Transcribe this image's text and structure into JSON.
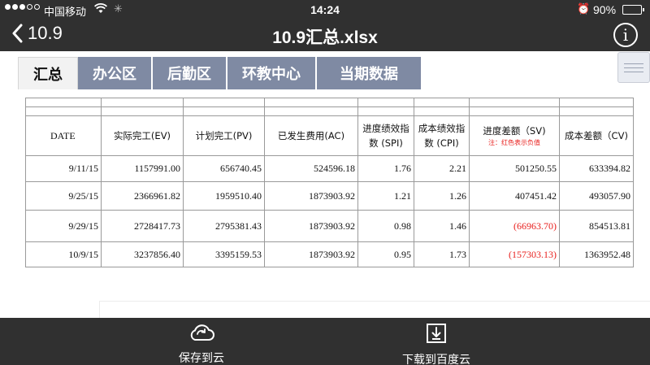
{
  "status_bar": {
    "carrier": "中国移动",
    "time": "14:24",
    "battery_percent": "90%",
    "battery_level": 0.9
  },
  "nav": {
    "back_label": "10.9",
    "title": "10.9汇总.xlsx",
    "info_label": "i"
  },
  "tabs": [
    {
      "label": "汇总",
      "active": true
    },
    {
      "label": "办公区",
      "active": false
    },
    {
      "label": "后勤区",
      "active": false
    },
    {
      "label": "环教中心",
      "active": false
    },
    {
      "label": "当期数据",
      "active": false
    }
  ],
  "table": {
    "headers": {
      "date": "DATE",
      "ev": "实际完工(EV)",
      "pv": "计划完工(PV)",
      "ac": "已发生费用(AC)",
      "spi": "进度绩效指数 (SPI)",
      "cpi": "成本绩效指数 (CPI)",
      "sv": "进度差额（SV)",
      "sv_note": "注：红色表示负值",
      "cv": "成本差额（CV)"
    },
    "rows": [
      {
        "date": "9/11/15",
        "ev": "1157991.00",
        "pv": "656740.45",
        "ac": "524596.18",
        "spi": "1.76",
        "cpi": "2.21",
        "sv": "501250.55",
        "cv": "633394.82"
      },
      {
        "date": "9/25/15",
        "ev": "2366961.82",
        "pv": "1959510.40",
        "ac": "1873903.92",
        "spi": "1.21",
        "cpi": "1.26",
        "sv": "407451.42",
        "cv": "493057.90"
      },
      {
        "date": "9/29/15",
        "ev": "2728417.73",
        "pv": "2795381.43",
        "ac": "1873903.92",
        "spi": "0.98",
        "cpi": "1.46",
        "sv": "(66963.70)",
        "cv": "854513.81"
      },
      {
        "date": "10/9/15",
        "ev": "3237856.40",
        "pv": "3395159.53",
        "ac": "1873903.92",
        "spi": "0.95",
        "cpi": "1.73",
        "sv": "(157303.13)",
        "cv": "1363952.48"
      }
    ],
    "negative_color": "#e8201e"
  },
  "bottom_bar": {
    "save_label": "保存到云",
    "download_label": "下载到百度云"
  },
  "colors": {
    "bar_background": "#303030",
    "tab_inactive": "#7f8aa3",
    "tab_active": "#f2f2f2"
  }
}
